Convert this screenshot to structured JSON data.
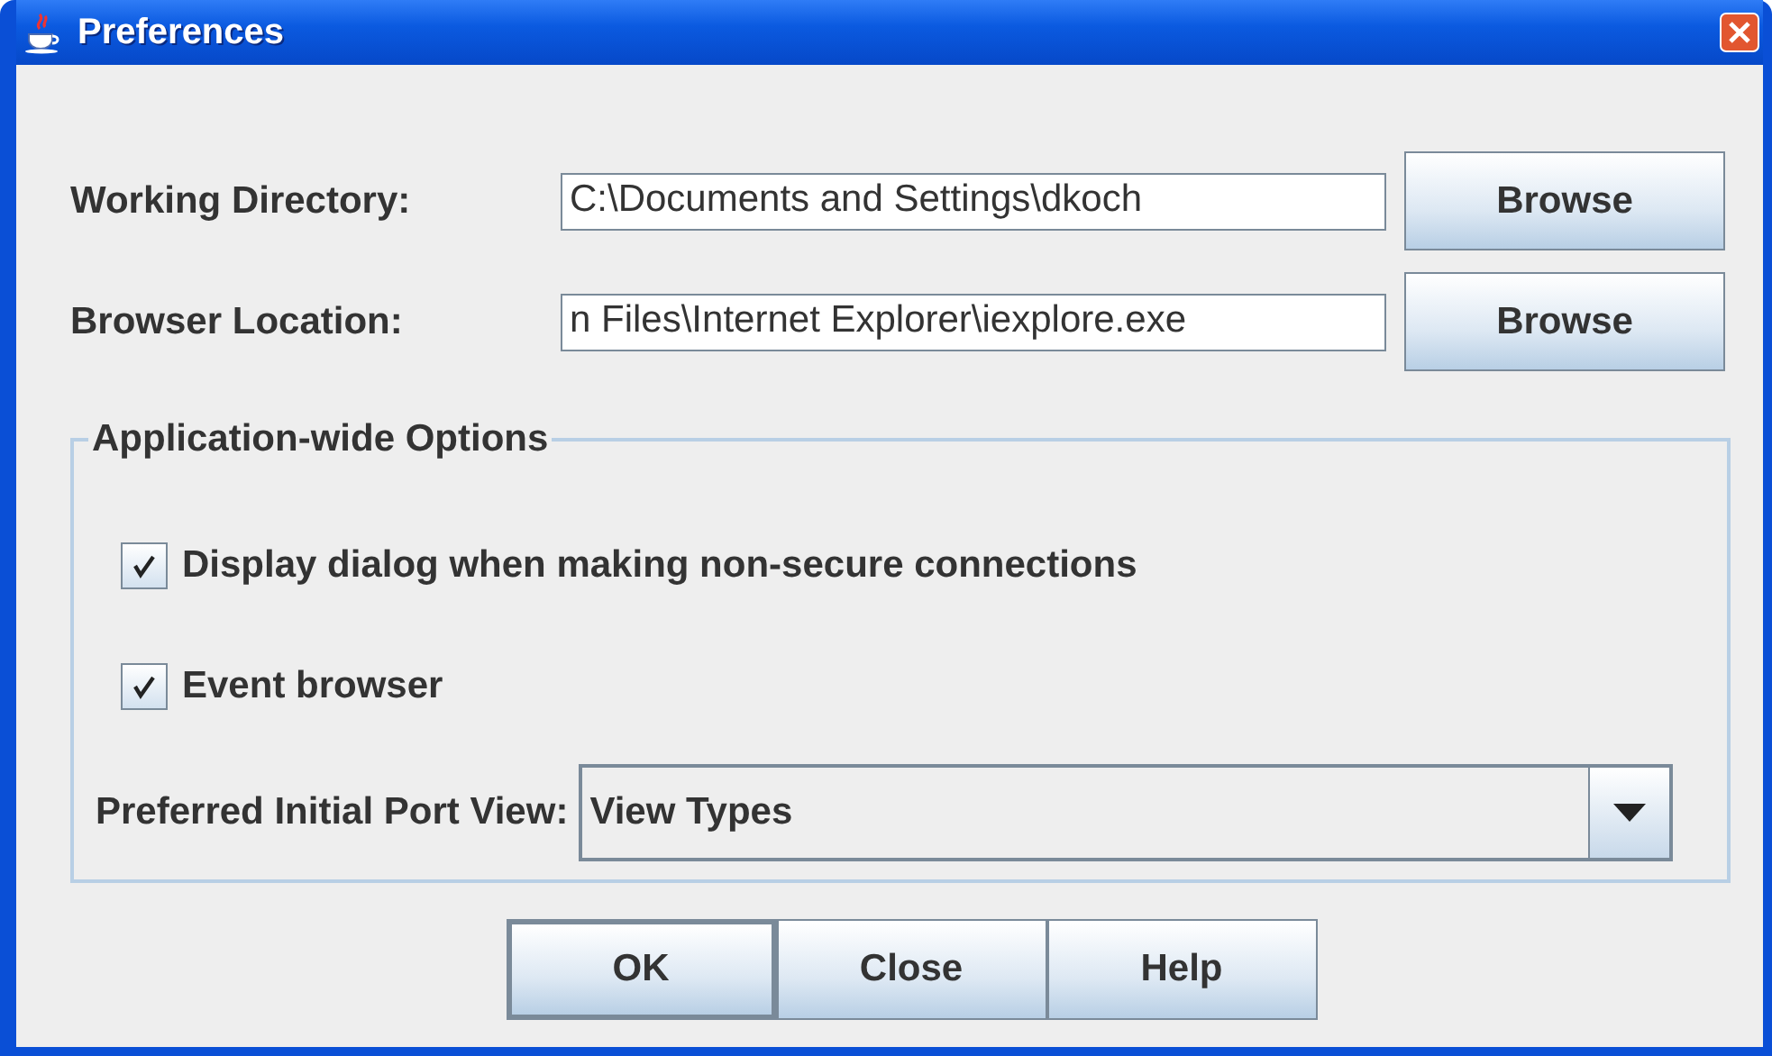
{
  "window": {
    "title": "Preferences"
  },
  "paths": [
    {
      "label": "Working Directory:",
      "value": "C:\\Documents and Settings\\dkoch",
      "button": "Browse"
    },
    {
      "label": "Browser Location:",
      "value": "n Files\\Internet Explorer\\iexplore.exe",
      "button": "Browse"
    }
  ],
  "options": {
    "title": "Application-wide Options",
    "checkboxes": [
      {
        "label": "Display dialog when making non-secure connections",
        "checked": true
      },
      {
        "label": "Event browser",
        "checked": true
      }
    ],
    "port_view": {
      "label": "Preferred Initial Port View:",
      "value": "View Types"
    }
  },
  "buttons": [
    {
      "label": "OK",
      "selected": true
    },
    {
      "label": "Close",
      "selected": false
    },
    {
      "label": "Help",
      "selected": false
    }
  ]
}
